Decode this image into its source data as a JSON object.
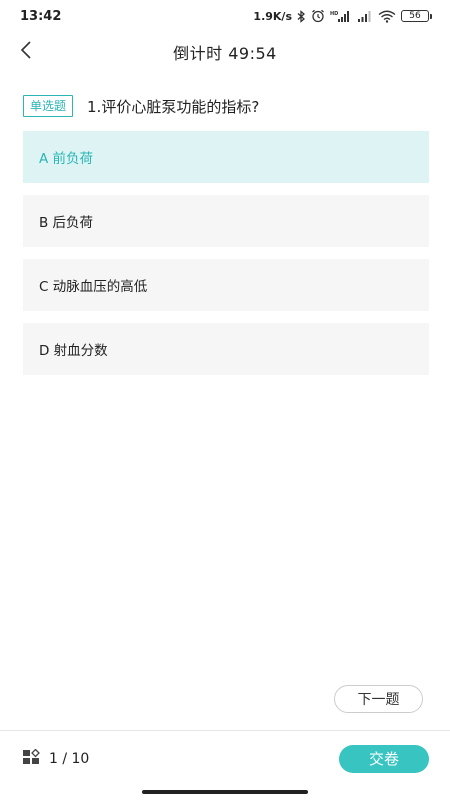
{
  "status_bar": {
    "time": "13:42",
    "speed": "1.9K/s",
    "hd_label": "HD",
    "battery": "56"
  },
  "header": {
    "title": "倒计时 49:54"
  },
  "question": {
    "type": "单选题",
    "text": "1.评价心脏泵功能的指标?",
    "selected_index": 0,
    "options": [
      {
        "label": "A 前负荷"
      },
      {
        "label": "B 后负荷"
      },
      {
        "label": "C 动脉血压的高低"
      },
      {
        "label": "D 射血分数"
      }
    ]
  },
  "next_label": "下一题",
  "footer": {
    "progress": "1 / 10",
    "submit_label": "交卷"
  },
  "colors": {
    "accent": "#38c5c2",
    "badge": "#2bb5b5",
    "selected_bg": "#def4f4",
    "option_bg": "#f6f6f6"
  },
  "icons": {
    "back": "chevron-left-icon",
    "grid": "grid-icon",
    "bluetooth": "bluetooth-icon",
    "alarm": "alarm-icon",
    "signal": "signal-icon",
    "wifi": "wifi-icon",
    "battery": "battery-icon"
  }
}
